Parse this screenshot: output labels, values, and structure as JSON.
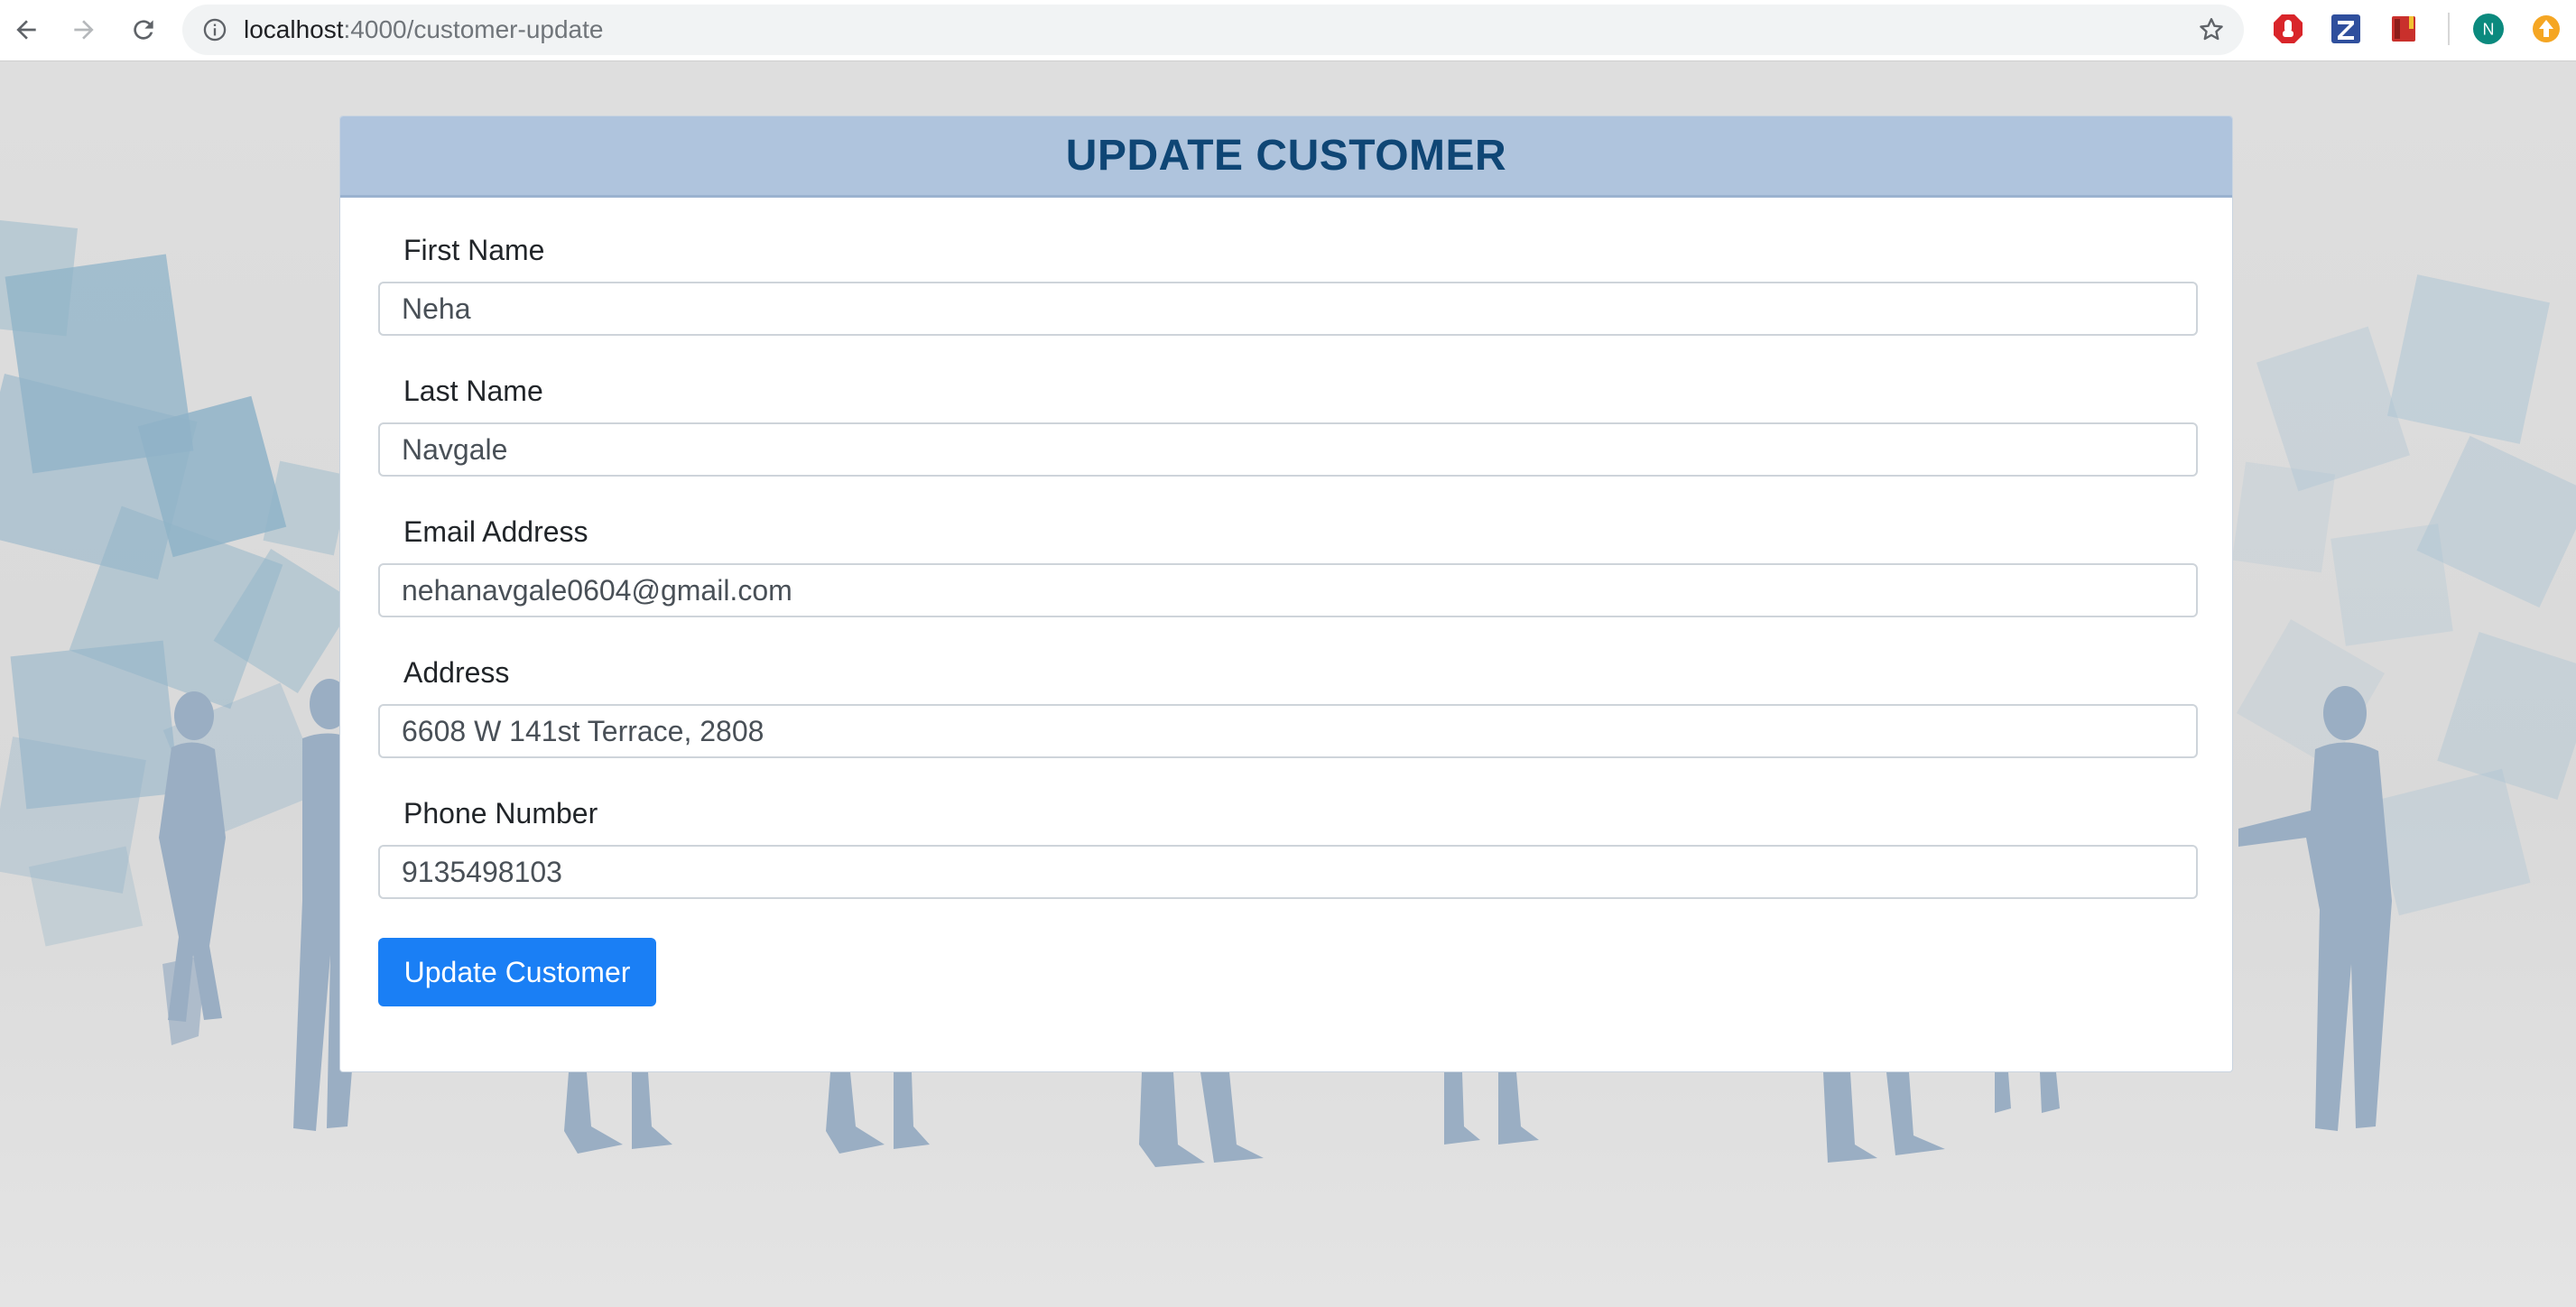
{
  "browser": {
    "url_host": "localhost",
    "url_path": ":4000/customer-update",
    "profile_initial": "N",
    "icons": [
      "back-icon",
      "forward-icon",
      "reload-icon",
      "info-icon",
      "star-icon"
    ],
    "extensions": [
      "stop-sign-extension-icon",
      "z-extension-icon",
      "red-book-extension-icon",
      "profile-avatar",
      "orange-extension-icon"
    ]
  },
  "form": {
    "title": "UPDATE CUSTOMER",
    "fields": [
      {
        "label": "First Name",
        "value": "Neha"
      },
      {
        "label": "Last Name",
        "value": "Navgale"
      },
      {
        "label": "Email Address",
        "value": "nehanavgale0604@gmail.com"
      },
      {
        "label": "Address",
        "value": "6608 W 141st Terrace, 2808"
      },
      {
        "label": "Phone Number",
        "value": "9135498103"
      }
    ],
    "submit_label": "Update Customer"
  },
  "colors": {
    "header_bg": "#afc4dd",
    "title_color": "#0f4675",
    "button_bg": "#1a7ff5",
    "silhouette": "#9aaec3",
    "tile": "#8fb3c8"
  }
}
